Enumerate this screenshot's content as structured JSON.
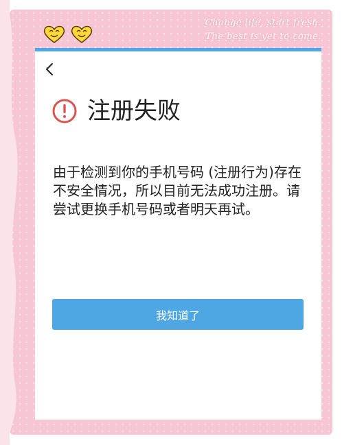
{
  "decor": {
    "slogan_line1": "Change life, start fresh.",
    "slogan_line2": "The best is yet to come."
  },
  "dialog": {
    "back_icon": "chevron-left-icon",
    "status_icon": "exclamation-circle-icon",
    "title": "注册失败",
    "message": "由于检测到你的手机号码 (注册行为)存在不安全情况，所以目前无法成功注册。请尝试更换手机号码或者明天再试。",
    "confirm_label": "我知道了"
  },
  "colors": {
    "accent": "#4ea6e3",
    "alert": "#d9534f",
    "background_pink": "#f7c6d4"
  }
}
